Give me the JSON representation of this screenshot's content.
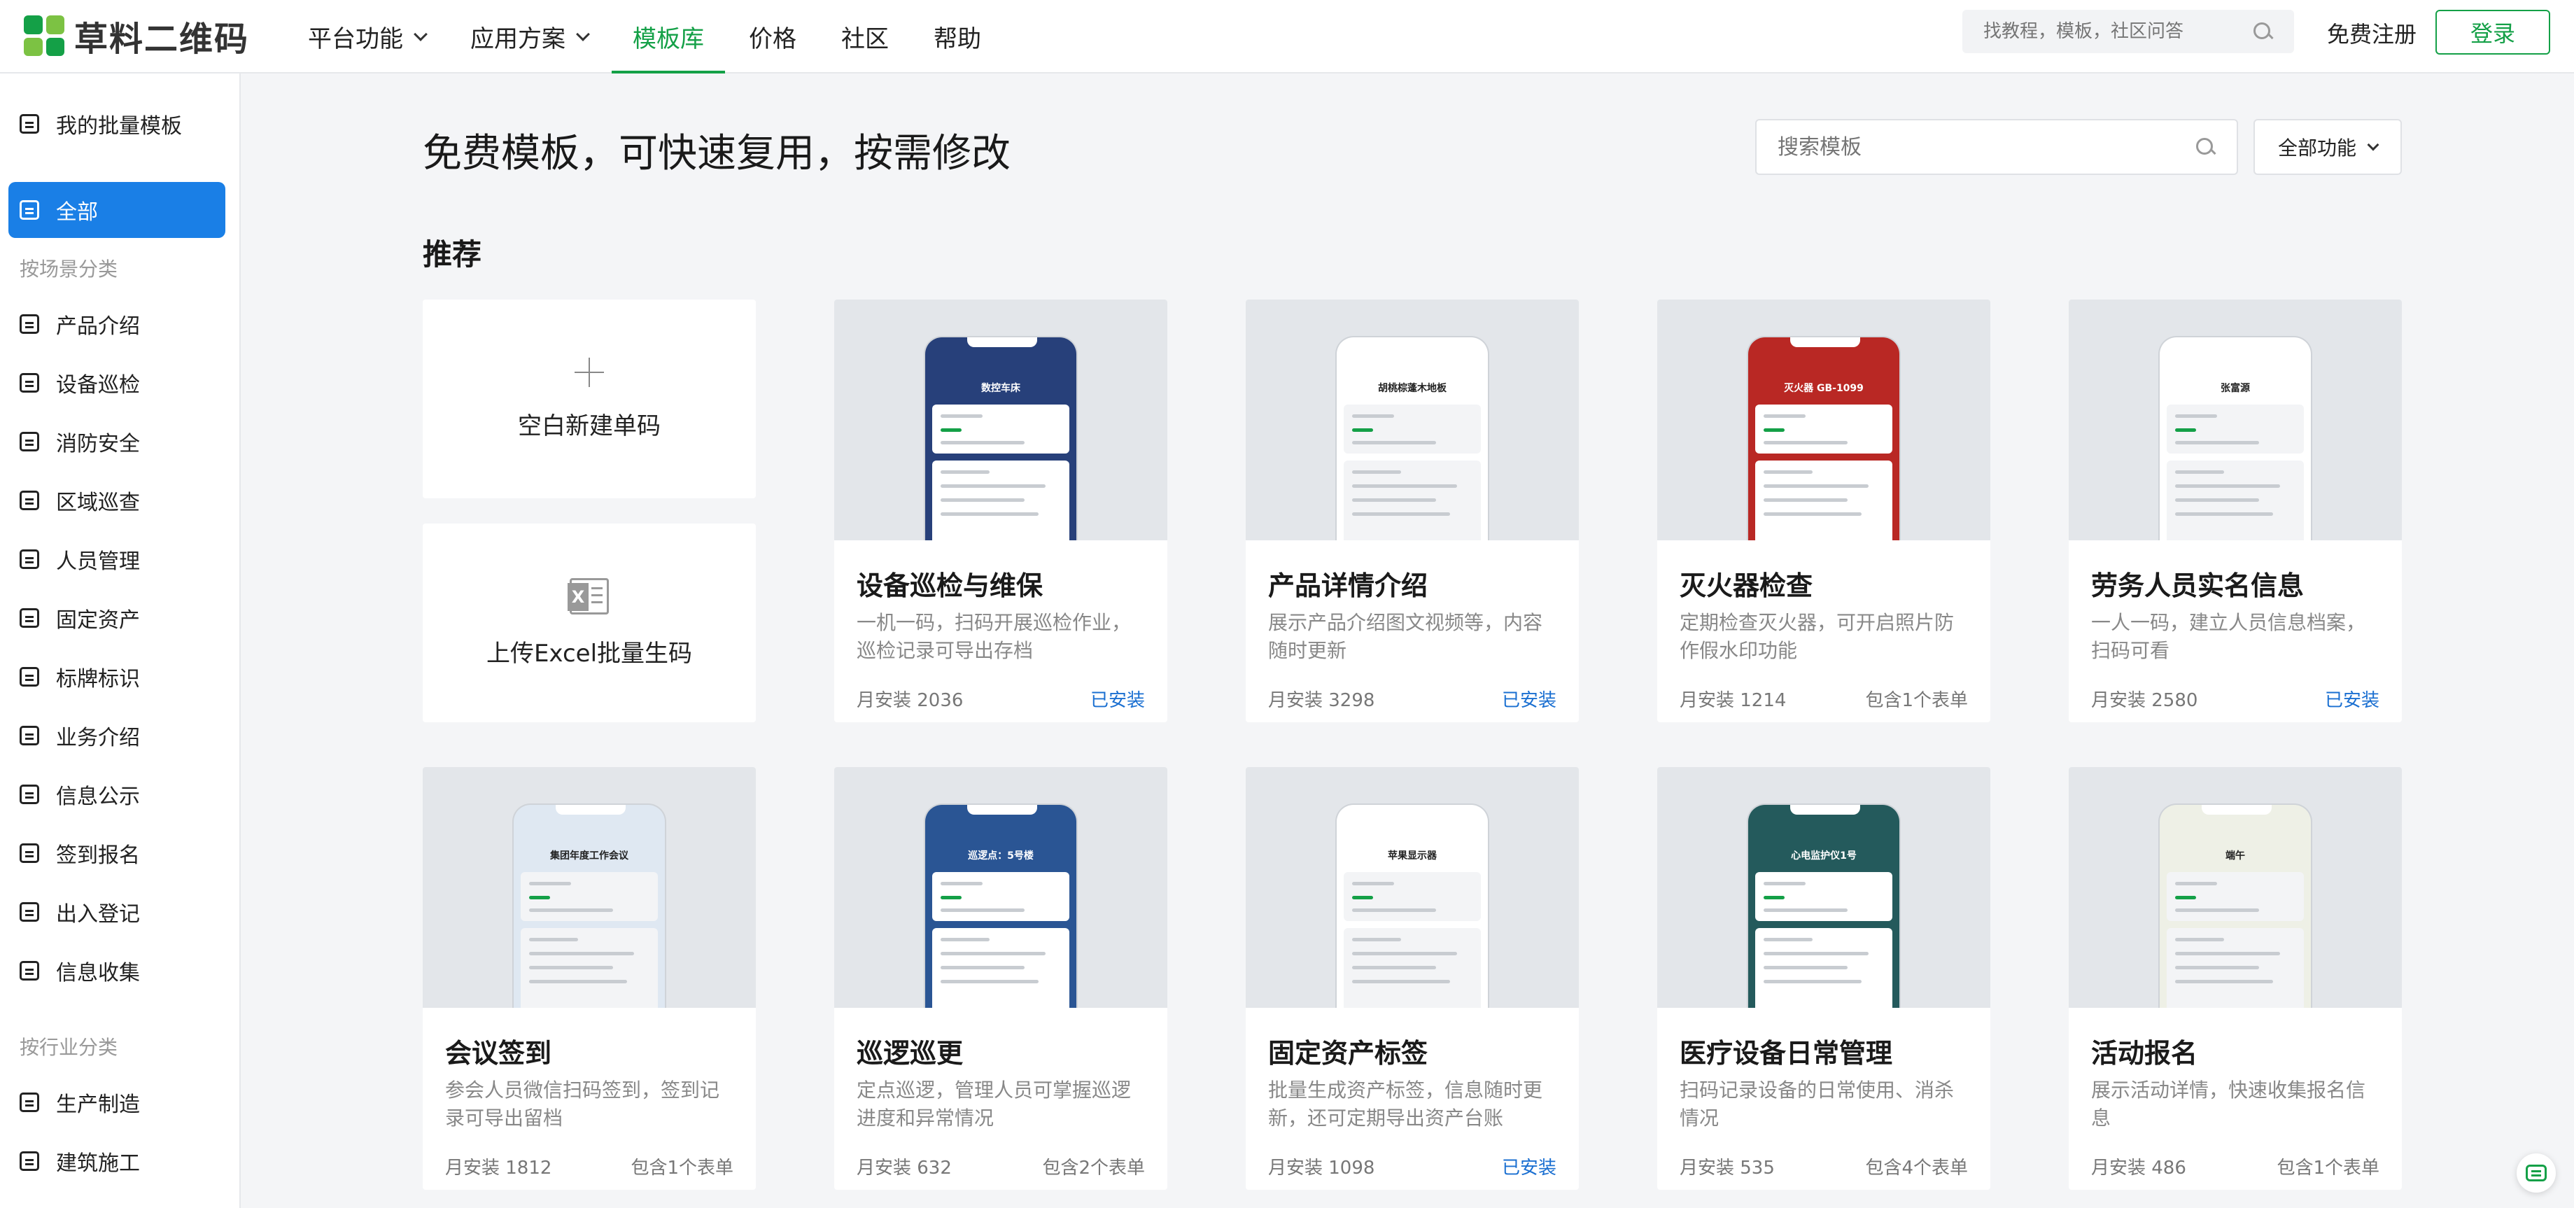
{
  "header": {
    "logo_text": "草料二维码",
    "nav": [
      {
        "label": "平台功能",
        "dropdown": true,
        "active": false
      },
      {
        "label": "应用方案",
        "dropdown": true,
        "active": false
      },
      {
        "label": "模板库",
        "dropdown": false,
        "active": true
      },
      {
        "label": "价格",
        "dropdown": false,
        "active": false
      },
      {
        "label": "社区",
        "dropdown": false,
        "active": false
      },
      {
        "label": "帮助",
        "dropdown": false,
        "active": false
      }
    ],
    "search_placeholder": "找教程，模板，社区问答",
    "register_label": "免费注册",
    "login_label": "登录"
  },
  "sidebar": {
    "my_templates": "我的批量模板",
    "all_label": "全部",
    "scene_section": "按场景分类",
    "scene_items": [
      "产品介绍",
      "设备巡检",
      "消防安全",
      "区域巡查",
      "人员管理",
      "固定资产",
      "标牌标识",
      "业务介绍",
      "信息公示",
      "签到报名",
      "出入登记",
      "信息收集"
    ],
    "industry_section": "按行业分类",
    "industry_items": [
      "生产制造",
      "建筑施工"
    ]
  },
  "main": {
    "title": "免费模板，可快速复用，按需修改",
    "search_placeholder": "搜索模板",
    "filter_label": "全部功能",
    "section_title": "推荐",
    "blank_card_label": "空白新建单码",
    "excel_card_label": "上传Excel批量生码",
    "cards": [
      {
        "title": "设备巡检与维保",
        "desc": "一机一码，扫码开展巡检作业，巡检记录可导出存档",
        "installs": "月安装 2036",
        "status": "已安装",
        "installed": true,
        "phone_title": "数控车床",
        "theme": "#27407a"
      },
      {
        "title": "产品详情介绍",
        "desc": "展示产品介绍图文视频等，内容随时更新",
        "installs": "月安装 3298",
        "status": "已安装",
        "installed": true,
        "phone_title": "胡桃棕蓬木地板",
        "theme": "#ffffff"
      },
      {
        "title": "灭火器检查",
        "desc": "定期检查灭火器，可开启照片防作假水印功能",
        "installs": "月安装 1214",
        "status": "包含1个表单",
        "installed": false,
        "phone_title": "灭火器 GB-1099",
        "theme": "#b92824"
      },
      {
        "title": "劳务人员实名信息",
        "desc": "一人一码，建立人员信息档案，扫码可看",
        "installs": "月安装 2580",
        "status": "已安装",
        "installed": true,
        "phone_title": "张富源",
        "theme": "#ffffff"
      },
      {
        "title": "会议签到",
        "desc": "参会人员微信扫码签到，签到记录可导出留档",
        "installs": "月安装 1812",
        "status": "包含1个表单",
        "installed": false,
        "phone_title": "集团年度工作会议",
        "theme": "#dfe8f2"
      },
      {
        "title": "巡逻巡更",
        "desc": "定点巡逻，管理人员可掌握巡逻进度和异常情况",
        "installs": "月安装 632",
        "status": "包含2个表单",
        "installed": false,
        "phone_title": "巡逻点：5号楼",
        "theme": "#2a5594"
      },
      {
        "title": "固定资产标签",
        "desc": "批量生成资产标签，信息随时更新，还可定期导出资产台账",
        "installs": "月安装 1098",
        "status": "已安装",
        "installed": true,
        "phone_title": "苹果显示器",
        "theme": "#ffffff"
      },
      {
        "title": "医疗设备日常管理",
        "desc": "扫码记录设备的日常使用、消杀情况",
        "installs": "月安装 535",
        "status": "包含4个表单",
        "installed": false,
        "phone_title": "心电监护仪1号",
        "theme": "#245a5c"
      },
      {
        "title": "活动报名",
        "desc": "展示活动详情，快速收集报名信息",
        "installs": "月安装 486",
        "status": "包含1个表单",
        "installed": false,
        "phone_title": "端午",
        "theme": "#eef0e6"
      }
    ]
  },
  "colors": {
    "brand_green": "#14a047",
    "active_blue": "#1a7fe6",
    "installed_blue": "#1a6fd1"
  }
}
